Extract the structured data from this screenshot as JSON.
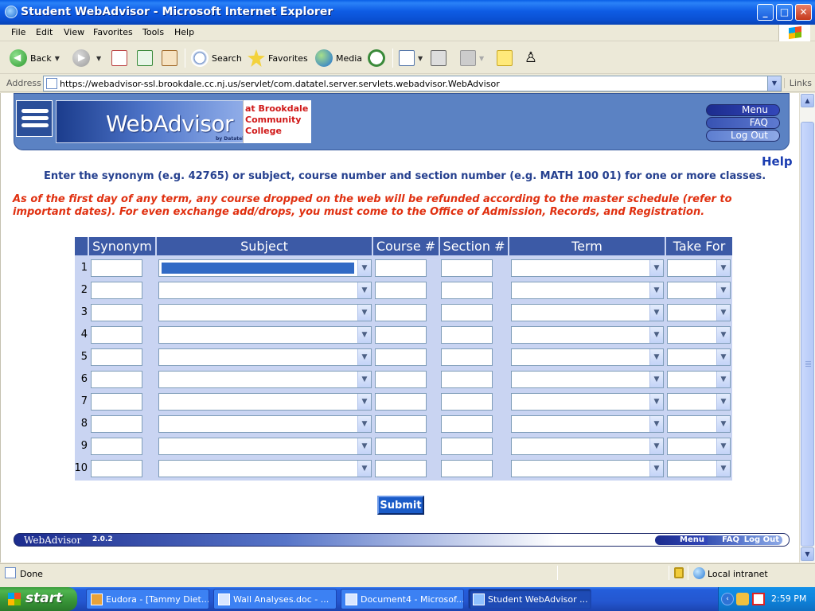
{
  "window": {
    "title": "Student WebAdvisor - Microsoft Internet Explorer",
    "minimize": "_",
    "maximize": "□",
    "close": "✕"
  },
  "menubar": [
    "File",
    "Edit",
    "View",
    "Favorites",
    "Tools",
    "Help"
  ],
  "toolbar": {
    "back": "Back",
    "search": "Search",
    "favorites": "Favorites",
    "media": "Media"
  },
  "address": {
    "label": "Address",
    "url": "https://webadvisor-ssl.brookdale.cc.nj.us/servlet/com.datatel.server.servlets.webadvisor.WebAdvisor",
    "links": "Links"
  },
  "banner": {
    "wordmark": "WebAdvisor",
    "by": "by Datatel",
    "college_lines": [
      "at Brookdale",
      "Community",
      "College"
    ],
    "nav": {
      "menu": "Menu",
      "faq": "FAQ",
      "logout": "Log Out"
    }
  },
  "page": {
    "help": "Help",
    "instructions": "Enter the synonym (e.g. 42765) or subject, course number and section number (e.g. MATH 100 01) for one or more classes.",
    "notice": "As of the first day of any term, any course dropped on the web will be refunded according to the master schedule (refer to important dates). For even exchange add/drops, you must come to the Office of Admission, Records, and Registration."
  },
  "table": {
    "headers": {
      "synonym": "Synonym",
      "subject": "Subject",
      "course": "Course #",
      "section": "Section #",
      "term": "Term",
      "take_for": "Take For"
    },
    "rows": [
      "1",
      "2",
      "3",
      "4",
      "5",
      "6",
      "7",
      "8",
      "9",
      "10"
    ]
  },
  "submit": "Submit",
  "footer": {
    "wordmark": "WebAdvisor",
    "version": "2.0.2",
    "menu": "Menu",
    "faq": "FAQ",
    "logout": "Log Out"
  },
  "status": {
    "text": "Done",
    "zone": "Local intranet"
  },
  "taskbar": {
    "start": "start",
    "tasks": [
      "Eudora - [Tammy Diet...",
      "Wall Analyses.doc - ...",
      "Document4 - Microsof...",
      "Student WebAdvisor ..."
    ],
    "clock": "2:59 PM"
  }
}
